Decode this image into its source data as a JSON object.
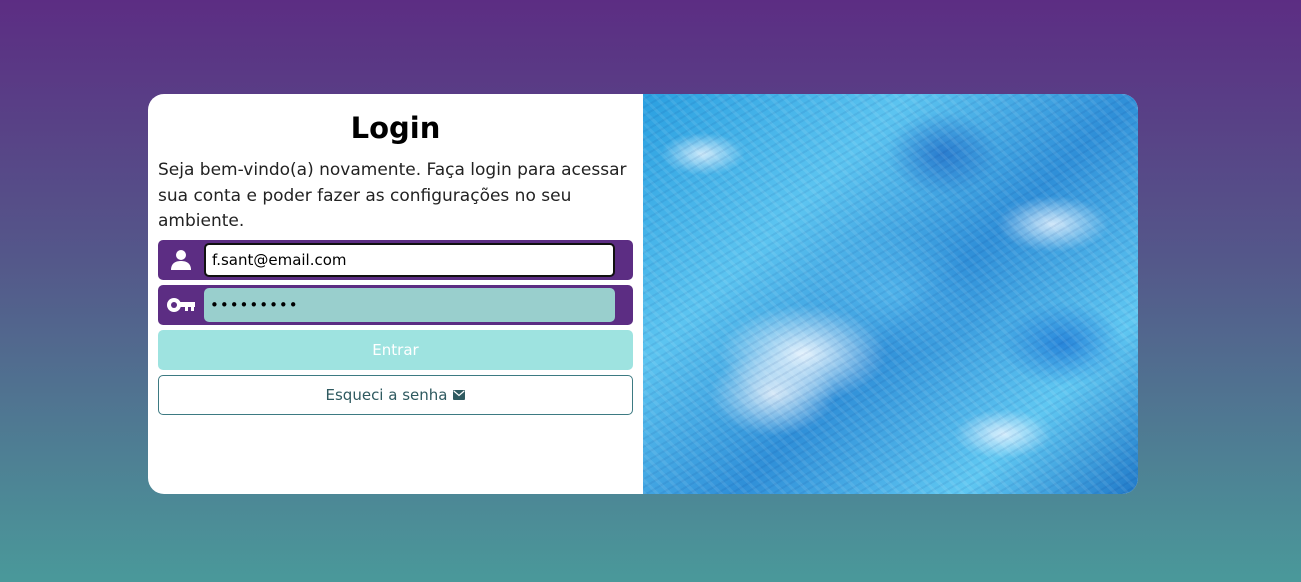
{
  "login": {
    "title": "Login",
    "description": "Seja bem-vindo(a) novamente. Faça login para acessar sua conta e poder fazer as configurações no seu ambiente.",
    "email": {
      "icon": "user-icon",
      "value": "f.sant@email.com"
    },
    "password": {
      "icon": "key-icon",
      "value": "•••••••••"
    },
    "enter_button": "Entrar",
    "forgot_button": {
      "label": "Esqueci a senha",
      "icon": "envelope-icon"
    }
  },
  "colors": {
    "accent": "#5c2d83",
    "enter_button_bg": "#9ee3e0",
    "password_field_bg": "#99cfcd",
    "forgot_border": "#3d7a82"
  },
  "side_image": {
    "description_icon": "abstract-blue-image"
  }
}
